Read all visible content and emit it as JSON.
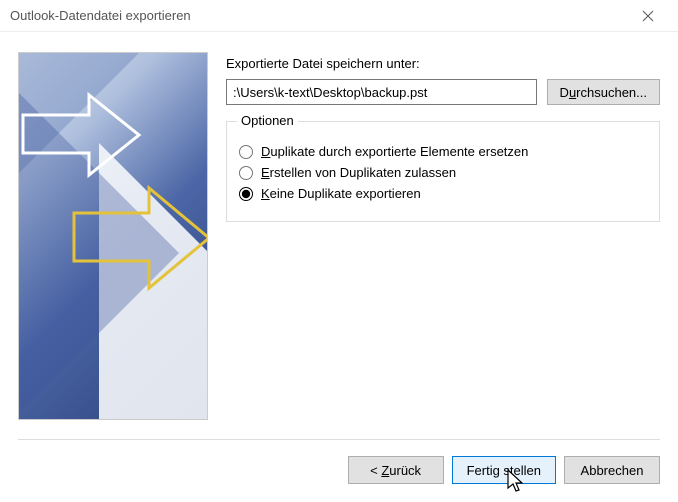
{
  "window": {
    "title": "Outlook-Datendatei exportieren"
  },
  "export": {
    "save_label": "Exportierte Datei speichern unter:",
    "path": ":\\Users\\k-text\\Desktop\\backup.pst",
    "browse_label": "Durchsuchen..."
  },
  "options": {
    "legend": "Optionen",
    "replace_label": "Duplikate durch exportierte Elemente ersetzen",
    "allow_label": "Erstellen von Duplikaten zulassen",
    "noexport_label": "Keine Duplikate exportieren",
    "selected": "noexport"
  },
  "buttons": {
    "back": "< Zurück",
    "finish": "Fertig stellen",
    "cancel": "Abbrechen"
  }
}
